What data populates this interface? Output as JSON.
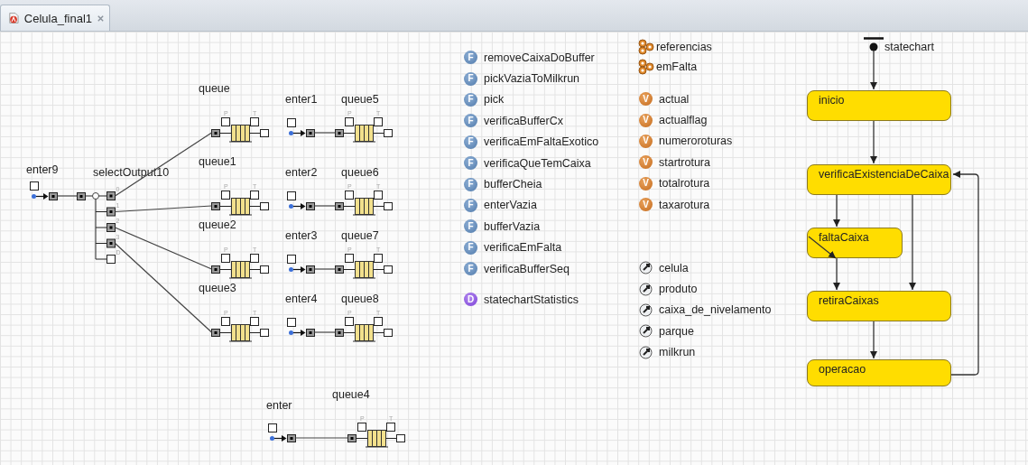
{
  "tab": {
    "title": "Celula_final1",
    "selected": true
  },
  "process_flow": {
    "source": {
      "label": "enter9"
    },
    "select_output": {
      "label": "selectOutput10",
      "exits": [
        "0",
        "1",
        "2",
        "3",
        "D"
      ]
    },
    "queues": [
      {
        "label": "queue",
        "ports": [
          "P",
          "T"
        ]
      },
      {
        "label": "queue1",
        "ports": [
          "P",
          "T"
        ]
      },
      {
        "label": "queue2",
        "ports": [
          "P",
          "T"
        ]
      },
      {
        "label": "queue3",
        "ports": [
          "P",
          "T"
        ]
      }
    ],
    "lines": [
      {
        "source": "enter1",
        "queue": {
          "label": "queue5",
          "ports": [
            "P",
            "T"
          ]
        }
      },
      {
        "source": "enter2",
        "queue": {
          "label": "queue6",
          "ports": [
            "P",
            "T"
          ]
        }
      },
      {
        "source": "enter3",
        "queue": {
          "label": "queue7",
          "ports": [
            "P",
            "T"
          ]
        }
      },
      {
        "source": "enter4",
        "queue": {
          "label": "queue8",
          "ports": [
            "P",
            "T"
          ]
        }
      }
    ],
    "bottom": {
      "source": "enter",
      "queue": {
        "label": "queue4",
        "ports": [
          "P",
          "T"
        ]
      }
    }
  },
  "functions": [
    {
      "kind": "function",
      "badge": "F",
      "name": "removeCaixaDoBuffer"
    },
    {
      "kind": "function",
      "badge": "F",
      "name": "pickVaziaToMilkrun"
    },
    {
      "kind": "function",
      "badge": "F",
      "name": "pick"
    },
    {
      "kind": "function",
      "badge": "F",
      "name": "verificaBufferCx"
    },
    {
      "kind": "function",
      "badge": "F",
      "name": "verificaEmFaltaExotico"
    },
    {
      "kind": "function",
      "badge": "F",
      "name": "verificaQueTemCaixa"
    },
    {
      "kind": "function",
      "badge": "F",
      "name": "bufferCheia"
    },
    {
      "kind": "function",
      "badge": "F",
      "name": "enterVazia"
    },
    {
      "kind": "function",
      "badge": "F",
      "name": "bufferVazia"
    },
    {
      "kind": "function",
      "badge": "F",
      "name": "verificaEmFalta"
    },
    {
      "kind": "function",
      "badge": "F",
      "name": "verificaBufferSeq"
    },
    {
      "kind": "dataset",
      "badge": "D",
      "name": "statechartStatistics"
    }
  ],
  "populations": [
    "referencias",
    "emFalta"
  ],
  "variables": [
    {
      "badge": "V",
      "name": "actual"
    },
    {
      "badge": "V",
      "name": "actualflag"
    },
    {
      "badge": "V",
      "name": "numeroroturas"
    },
    {
      "badge": "V",
      "name": "startrotura"
    },
    {
      "badge": "V",
      "name": "totalrotura"
    },
    {
      "badge": "V",
      "name": "taxarotura"
    }
  ],
  "parameters": [
    "celula",
    "produto",
    "caixa_de_nivelamento",
    "parque",
    "milkrun"
  ],
  "statechart": {
    "name": "statechart",
    "states": [
      "inicio",
      "verificaExistenciaDeCaixa",
      "faltaCaixa",
      "retiraCaixas",
      "operacao"
    ]
  }
}
